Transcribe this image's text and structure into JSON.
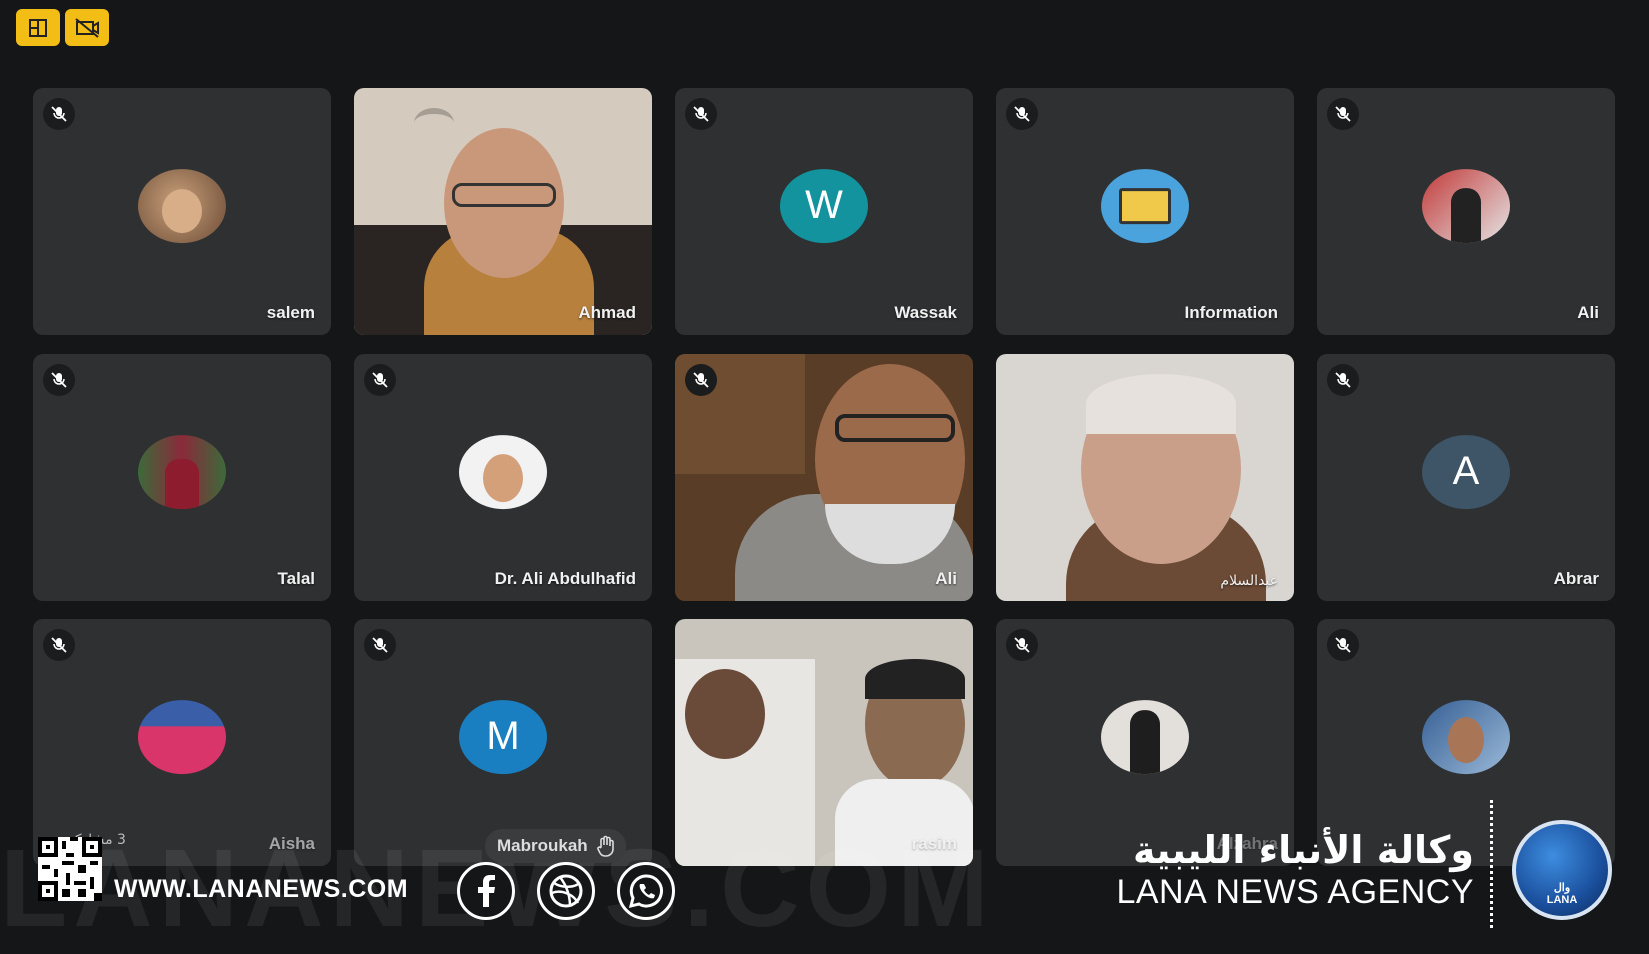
{
  "toolbar": {
    "btn1_icon": "layout-icon",
    "btn2_icon": "hide-video-icon"
  },
  "participants": [
    {
      "name": "salem",
      "type": "photo-avatar",
      "muted": true
    },
    {
      "name": "Ahmad",
      "type": "video",
      "muted": false
    },
    {
      "name": "Wassak",
      "type": "letter",
      "letter": "W",
      "color": "#12939d",
      "muted": true
    },
    {
      "name": "Information",
      "type": "photo-avatar",
      "muted": true
    },
    {
      "name": "Ali",
      "type": "photo-avatar",
      "muted": true
    },
    {
      "name": "Talal",
      "type": "photo-avatar",
      "muted": true
    },
    {
      "name": "Dr. Ali Abdulhafid",
      "type": "photo-avatar",
      "muted": true
    },
    {
      "name": "Ali",
      "type": "video",
      "muted": true
    },
    {
      "name": "عبدالسلام",
      "type": "video",
      "muted": false
    },
    {
      "name": "Abrar",
      "type": "letter",
      "letter": "A",
      "color": "#3d5566",
      "muted": true
    },
    {
      "name": "Aisha",
      "type": "photo-avatar",
      "muted": true
    },
    {
      "name": "Mabroukah",
      "type": "letter",
      "letter": "M",
      "color": "#1a7fc0",
      "muted": true
    },
    {
      "name": "rasim",
      "type": "video",
      "muted": false
    },
    {
      "name": "Alzahra",
      "type": "photo-avatar",
      "muted": true
    },
    {
      "name": "",
      "type": "photo-avatar",
      "muted": true
    }
  ],
  "overflow_count": "3 مشاركين",
  "footer": {
    "watermark": "LANANEWS.COM",
    "site": "WWW.LANANEWS.COM",
    "agency_ar": "وكالة الأنباء الليبية",
    "agency_en": "LANA NEWS AGENCY",
    "logo_ar": "وال",
    "logo_en": "LANA",
    "social": [
      "facebook-icon",
      "dribbble-icon",
      "whatsapp-icon"
    ]
  },
  "colors": {
    "accent": "#f2bd14",
    "tile": "#2e3032",
    "background": "#151617"
  }
}
